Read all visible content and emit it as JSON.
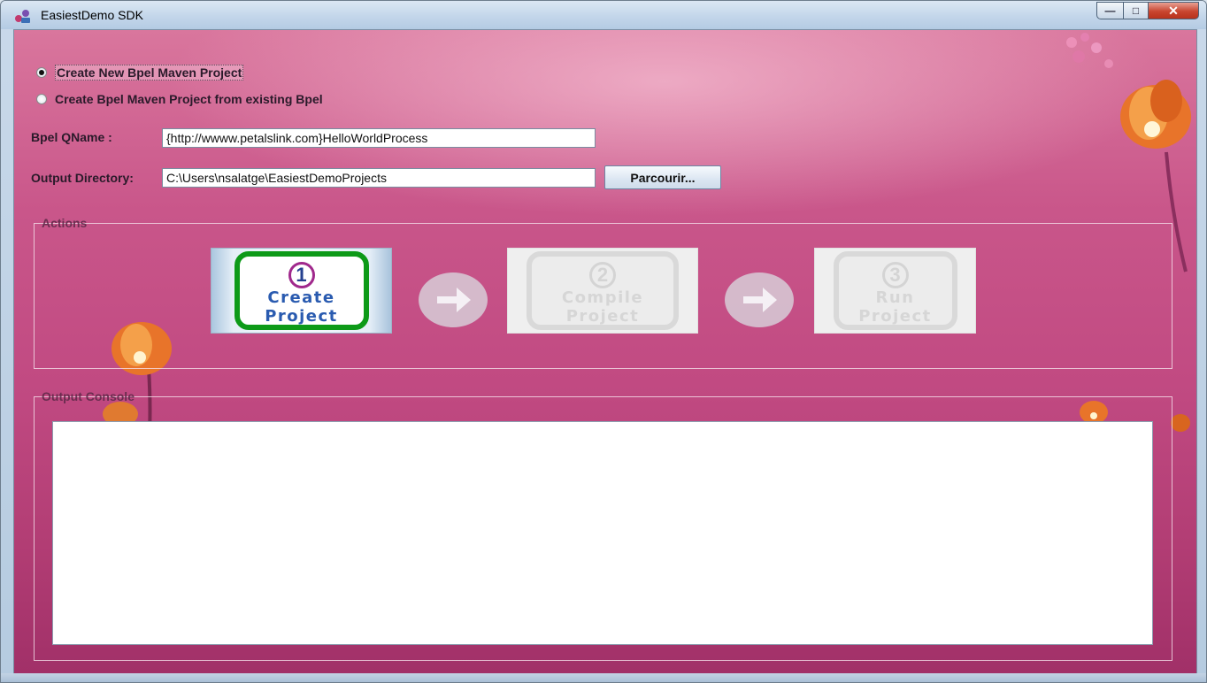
{
  "window": {
    "title": "EasiestDemo SDK",
    "controls": {
      "minimize": "—",
      "maximize": "□",
      "close": "✕"
    }
  },
  "options": [
    {
      "label": "Create New Bpel Maven Project",
      "selected": true
    },
    {
      "label": "Create Bpel Maven Project from existing Bpel",
      "selected": false
    }
  ],
  "form": {
    "qname_label": "Bpel QName :",
    "qname_value": "{http://wwww.petalslink.com}HelloWorldProcess",
    "output_dir_label": "Output Directory:",
    "output_dir_value": "C:\\Users\\nsalatge\\EasiestDemoProjects",
    "browse_label": "Parcourir..."
  },
  "actions": {
    "title": "Actions",
    "steps": [
      {
        "number": "1",
        "line1": "Create",
        "line2": "Project",
        "enabled": true
      },
      {
        "number": "2",
        "line1": "Compile",
        "line2": "Project",
        "enabled": false
      },
      {
        "number": "3",
        "line1": "Run",
        "line2": "Project",
        "enabled": false
      }
    ]
  },
  "console": {
    "title": "Output Console",
    "content": ""
  },
  "colors": {
    "background_top": "#d9769d",
    "background_bottom": "#a13068",
    "step_active_border": "#0d9a18",
    "step_active_text": "#2a5bb0",
    "step_number_ring": "#a0288c"
  }
}
